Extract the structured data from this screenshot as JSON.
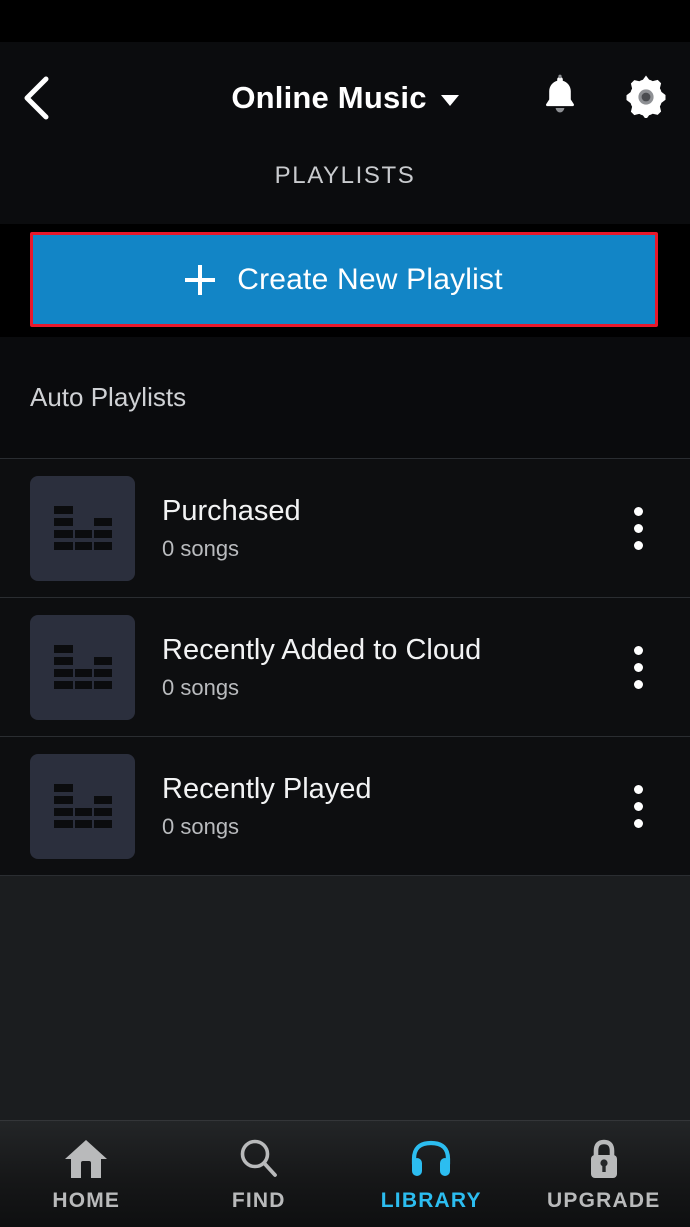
{
  "header": {
    "back_icon": "chevron-left-icon",
    "title": "Online Music",
    "dropdown_icon": "caret-down-icon",
    "notifications_icon": "bell-icon",
    "settings_icon": "gear-icon",
    "tab_label": "PLAYLISTS"
  },
  "create": {
    "plus_icon": "plus-icon",
    "label": "Create New Playlist",
    "button_color": "#1285c6",
    "highlight_color": "#e8182b"
  },
  "section": {
    "label": "Auto Playlists"
  },
  "playlists": [
    {
      "title": "Purchased",
      "subtitle": "0 songs",
      "thumb_icon": "equalizer-icon",
      "menu_icon": "more-vertical-icon"
    },
    {
      "title": "Recently Added to Cloud",
      "subtitle": "0 songs",
      "thumb_icon": "equalizer-icon",
      "menu_icon": "more-vertical-icon"
    },
    {
      "title": "Recently Played",
      "subtitle": "0 songs",
      "thumb_icon": "equalizer-icon",
      "menu_icon": "more-vertical-icon"
    }
  ],
  "bottom_nav": {
    "active_color": "#2cbdf0",
    "inactive_color": "#b9babb",
    "items": [
      {
        "label": "HOME",
        "icon": "home-icon",
        "active": false
      },
      {
        "label": "FIND",
        "icon": "search-icon",
        "active": false
      },
      {
        "label": "LIBRARY",
        "icon": "headphones-icon",
        "active": true
      },
      {
        "label": "UPGRADE",
        "icon": "lock-icon",
        "active": false
      }
    ]
  }
}
